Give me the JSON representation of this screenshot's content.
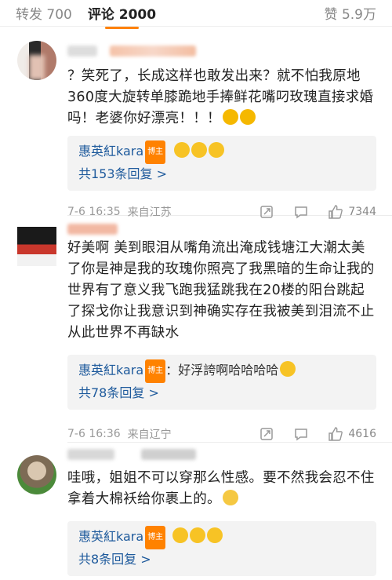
{
  "tabs": {
    "repost": "转发 700",
    "comments": "评论 2000",
    "likes": "赞 5.9万"
  },
  "comments": [
    {
      "text": "？笑死了，长成这样也敢发出来？就不怕我原地360度大旋转单膝跪地手捧鲜花嘴叼玫瑰直接求婚吗！老婆你好漂亮！！！",
      "reply_user": "惠英紅kara",
      "reply_badge": "博主",
      "reply_text": "",
      "reply_count": "共153条回复 >",
      "time": "7-6 16:35",
      "location": "来自江苏",
      "likes": "7344"
    },
    {
      "text": "好美啊 美到眼泪从嘴角流出淹成钱塘江大潮太美了你是神是我的玫瑰你照亮了我黑暗的生命让我的世界有了意义我飞跑我猛跳我在20楼的阳台跳起了探戈你让我意识到神确实存在我被美到泪流不止从此世界不再缺水",
      "reply_user": "惠英紅kara",
      "reply_badge": "博主",
      "reply_text": "：好浮誇啊哈哈哈哈",
      "reply_count": "共78条回复 >",
      "time": "7-6 16:36",
      "location": "来自辽宁",
      "likes": "4616"
    },
    {
      "text": "哇哦，姐姐不可以穿那么性感。要不然我会忍不住拿着大棉袄给你裹上的。",
      "reply_user": "惠英紅kara",
      "reply_badge": "博主",
      "reply_text": "",
      "reply_count": "共8条回复 >",
      "time": "",
      "location": "",
      "likes": ""
    }
  ],
  "colors": {
    "accent": "#ff8200",
    "link": "#1e5a9c",
    "reply_bg": "#f3f3f3"
  }
}
